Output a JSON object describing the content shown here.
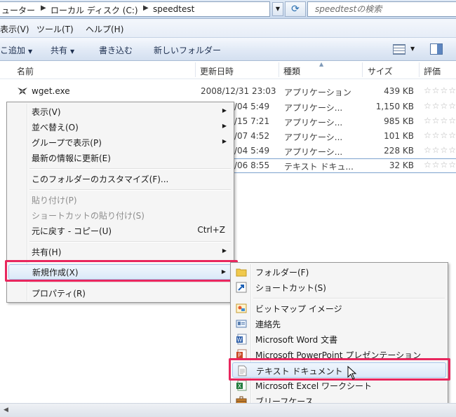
{
  "address": {
    "crumbs": [
      "ューター",
      "ローカル ディスク (C:)",
      "speedtest"
    ],
    "search_placeholder": "speedtestの検索"
  },
  "menubar": [
    "表示(V)",
    "ツール(T)",
    "ヘルプ(H)"
  ],
  "toolbar": {
    "items": [
      "こ追加",
      "共有",
      "書き込む",
      "新しいフォルダー"
    ]
  },
  "columns": {
    "name": "名前",
    "modified": "更新日時",
    "type": "種類",
    "size": "サイズ",
    "rating": "評価"
  },
  "files": [
    {
      "name": "wget.exe",
      "modified": "2008/12/31 23:03",
      "type": "アプリケーション",
      "size": "439 KB",
      "rating": "☆☆☆☆"
    },
    {
      "name": "",
      "modified": "/04 5:49",
      "type": "アプリケーシ...",
      "size": "1,150 KB",
      "rating": "☆☆☆☆"
    },
    {
      "name": "",
      "modified": "/15 7:21",
      "type": "アプリケーシ...",
      "size": "985 KB",
      "rating": "☆☆☆☆"
    },
    {
      "name": "",
      "modified": "/07 4:52",
      "type": "アプリケーシ...",
      "size": "101 KB",
      "rating": "☆☆☆☆"
    },
    {
      "name": "",
      "modified": "/04 5:49",
      "type": "アプリケーシ...",
      "size": "228 KB",
      "rating": "☆☆☆☆"
    },
    {
      "name": "",
      "modified": "/06 8:55",
      "type": "テキスト ドキュ...",
      "size": "32 KB",
      "rating": "☆☆☆☆"
    }
  ],
  "context_menu": {
    "view": "表示(V)",
    "sort": "並べ替え(O)",
    "group": "グループで表示(P)",
    "refresh": "最新の情報に更新(E)",
    "customize": "このフォルダーのカスタマイズ(F)...",
    "paste": "貼り付け(P)",
    "paste_shortcut": "ショートカットの貼り付け(S)",
    "undo": "元に戻す - コピー(U)",
    "undo_shortcut": "Ctrl+Z",
    "share": "共有(H)",
    "new": "新規作成(X)",
    "properties": "プロパティ(R)"
  },
  "submenu": {
    "folder": "フォルダー(F)",
    "shortcut": "ショートカット(S)",
    "bitmap": "ビットマップ イメージ",
    "contact": "連絡先",
    "word": "Microsoft Word 文書",
    "powerpoint": "Microsoft PowerPoint プレゼンテーション",
    "text": "テキスト ドキュメント",
    "excel": "Microsoft Excel ワークシート",
    "briefcase": "ブリーフケース"
  },
  "colors": {
    "highlight_border": "#e8275e",
    "menu_hover": "#dce9f8"
  }
}
